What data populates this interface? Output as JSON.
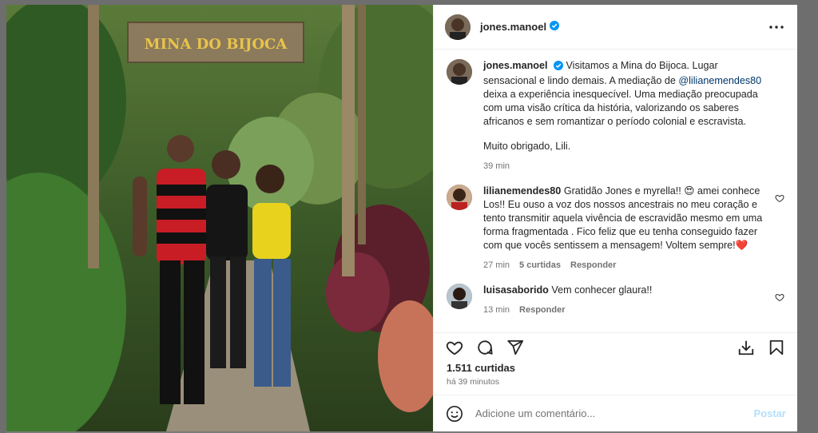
{
  "post": {
    "username": "jones.manoel",
    "verified": true,
    "caption_username": "jones.manoel",
    "caption_text_1": "Visitamos a Mina do Bijoca. Lugar sensacional e lindo demais. A mediação de ",
    "caption_mention": "@lilianemendes80",
    "caption_text_2": " deixa a experiência inesquecível. Uma mediação preocupada com uma visão crítica da história, valorizando os saberes africanos e sem romantizar o período colonial e escravista.",
    "caption_thanks": "Muito obrigado, Lili.",
    "caption_time": "39 min",
    "likes": "1.511 curtidas",
    "posted_ago": "há 39 minutos"
  },
  "photo": {
    "sign_text": "MINA DO BIJOCA"
  },
  "comments": [
    {
      "username": "lilianemendes80",
      "text": "Gratidão Jones e myrella!! 😍 amei conhece Los!! Eu ouso a voz dos nossos ancestrais no meu coração e tento transmitir aquela vivência de escravidão mesmo em uma forma fragmentada . Fico feliz que eu tenha conseguido fazer com que vocês sentissem a mensagem! Voltem sempre!❤️",
      "time": "27 min",
      "likes": "5 curtidas",
      "reply": "Responder"
    },
    {
      "username": "luisasaborido",
      "text": "Vem conhecer glaura!!",
      "time": "13 min",
      "reply": "Responder"
    }
  ],
  "add_comment": {
    "placeholder": "Adicione um comentário...",
    "post_label": "Postar"
  },
  "icons": {
    "more": "more-options-icon",
    "like": "heart-icon",
    "comment": "comment-icon",
    "share": "send-icon",
    "download": "download-icon",
    "save": "bookmark-icon",
    "emoji": "emoji-icon"
  },
  "colors": {
    "verified_blue": "#0095f6",
    "mention": "#00376b",
    "post_disabled": "#b2dffc"
  }
}
